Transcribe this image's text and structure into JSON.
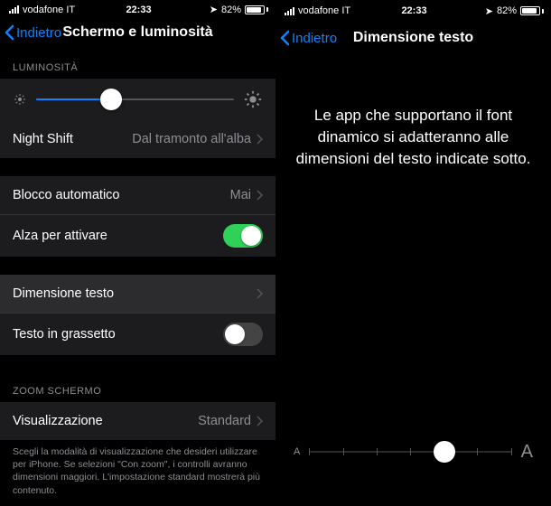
{
  "status": {
    "carrier": "vodafone IT",
    "time": "22:33",
    "battery_pct": "82%"
  },
  "screenA": {
    "back": "Indietro",
    "title": "Schermo e luminosità",
    "section_brightness": "LUMINOSITÀ",
    "brightness_value_pct": 38,
    "night_shift": {
      "label": "Night Shift",
      "value": "Dal tramonto all'alba"
    },
    "auto_lock": {
      "label": "Blocco automatico",
      "value": "Mai"
    },
    "raise_to_wake": {
      "label": "Alza per attivare",
      "on": true
    },
    "text_size": {
      "label": "Dimensione testo"
    },
    "bold_text": {
      "label": "Testo in grassetto",
      "on": false
    },
    "section_zoom": "ZOOM SCHERMO",
    "display_zoom": {
      "label": "Visualizzazione",
      "value": "Standard"
    },
    "footer": "Scegli la modalità di visualizzazione che desideri utilizzare per iPhone. Se selezioni \"Con zoom\", i controlli avranno dimensioni maggiori. L'impostazione standard mostrerà più contenuto."
  },
  "screenB": {
    "back": "Indietro",
    "title": "Dimensione testo",
    "message": "Le app che supportano il font dinamico si adatteranno alle dimensioni del testo indicate sotto.",
    "slider_steps": 7,
    "slider_index": 4
  }
}
